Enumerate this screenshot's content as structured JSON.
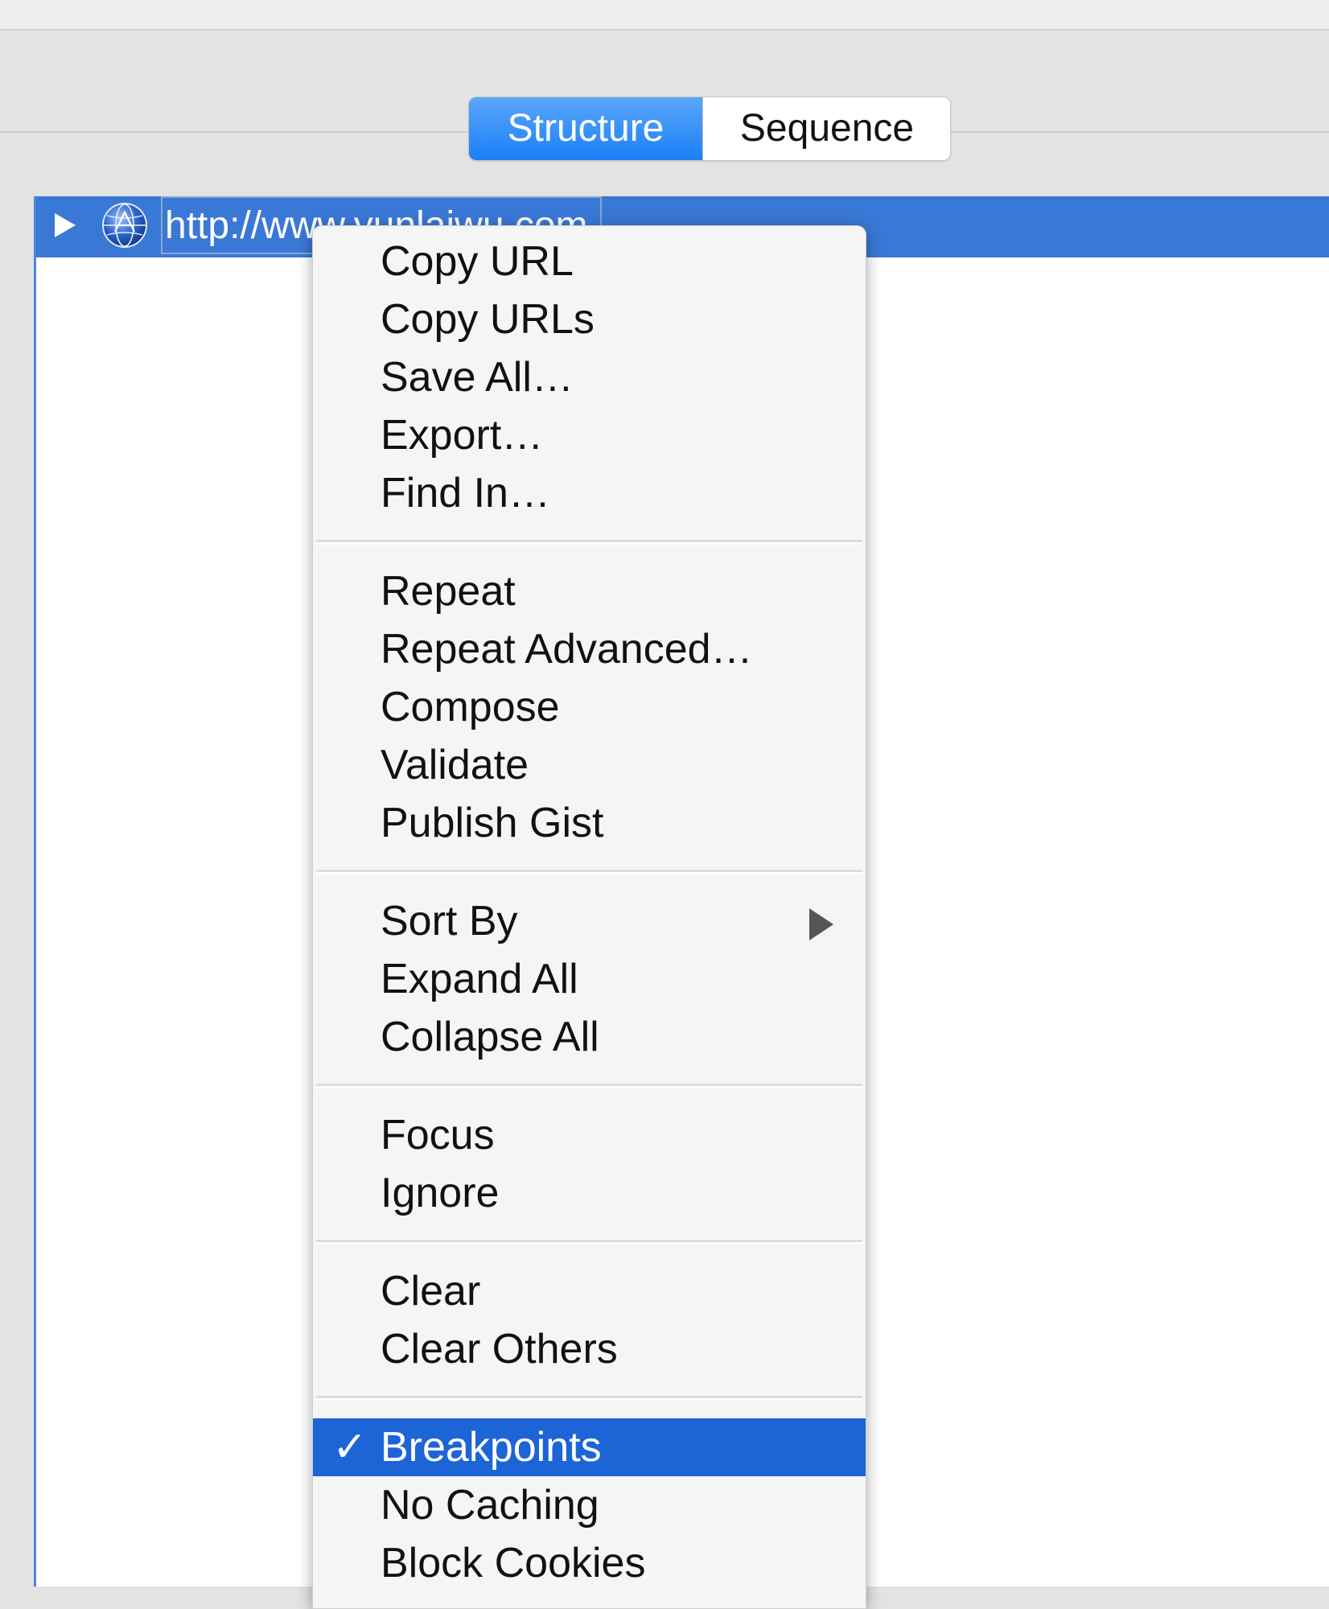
{
  "toolbar": {
    "tabs": [
      {
        "label": "Structure",
        "active": true
      },
      {
        "label": "Sequence",
        "active": false
      }
    ]
  },
  "outline": {
    "row": {
      "url": "http://www.yunlaiwu.com",
      "icon": "globe-icon"
    }
  },
  "context_menu": {
    "groups": [
      [
        "Copy URL",
        "Copy URLs",
        "Save All…",
        "Export…",
        "Find In…"
      ],
      [
        "Repeat",
        "Repeat Advanced…",
        "Compose",
        "Validate",
        "Publish Gist"
      ],
      [
        "Sort By",
        "Expand All",
        "Collapse All"
      ],
      [
        "Focus",
        "Ignore"
      ],
      [
        "Clear",
        "Clear Others"
      ],
      [
        "Breakpoints",
        "No Caching",
        "Block Cookies"
      ]
    ],
    "checked_item": "Breakpoints",
    "highlighted_item": "Breakpoints",
    "submenu_item": "Sort By",
    "check_glyph": "✓"
  },
  "colors": {
    "accent": "#1b80f4",
    "selection_row": "#3a78d6",
    "menu_highlight": "#1d65d6"
  }
}
